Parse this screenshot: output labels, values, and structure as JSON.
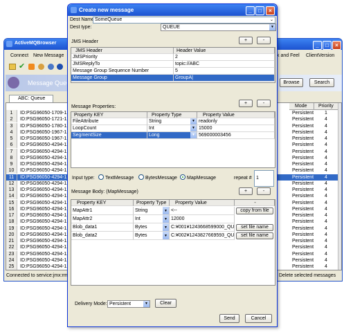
{
  "bg": {
    "title": "ActiveMQBrowser",
    "menu_left": [
      "Connect",
      "New Message"
    ],
    "menu_right": [
      "k and Feel",
      "ClientVersion"
    ],
    "band": "Message Queue",
    "browse": "Browse",
    "search": "Search",
    "tab": "ABC: Queue",
    "col_mode": "Mode",
    "col_priority": "Priority",
    "rows": [
      {
        "n": "1",
        "id": "ID:PSG96050-1709-12",
        "m": "Persistent",
        "p": "1"
      },
      {
        "n": "2",
        "id": "ID:PSG96050-1721-12",
        "m": "Persistent",
        "p": "4"
      },
      {
        "n": "3",
        "id": "ID:PSG96050-1780-12",
        "m": "Persistent",
        "p": "4"
      },
      {
        "n": "4",
        "id": "ID:PSG96050-1967-12",
        "m": "Persistent",
        "p": "4"
      },
      {
        "n": "5",
        "id": "ID:PSG96050-1967-12",
        "m": "Persistent",
        "p": "4"
      },
      {
        "n": "6",
        "id": "ID:PSG96050-4294-12",
        "m": "Persistent",
        "p": "4"
      },
      {
        "n": "7",
        "id": "ID:PSG96050-4294-12",
        "m": "Persistent",
        "p": "4"
      },
      {
        "n": "8",
        "id": "ID:PSG96050-4294-12",
        "m": "Persistent",
        "p": "4"
      },
      {
        "n": "9",
        "id": "ID:PSG96050-4294-12",
        "m": "Persistent",
        "p": "4"
      },
      {
        "n": "10",
        "id": "ID:PSG96050-4294-12",
        "m": "Persistent",
        "p": "4"
      },
      {
        "n": "11",
        "id": "ID:PSG96050-4294-12",
        "m": "Persistent",
        "p": "4"
      },
      {
        "n": "12",
        "id": "ID:PSG96050-4294-12",
        "m": "Persistent",
        "p": "4"
      },
      {
        "n": "13",
        "id": "ID:PSG96050-4294-12",
        "m": "Persistent",
        "p": "4"
      },
      {
        "n": "14",
        "id": "ID:PSG96050-4294-12",
        "m": "Persistent",
        "p": "4"
      },
      {
        "n": "15",
        "id": "ID:PSG96050-4294-12",
        "m": "Persistent",
        "p": "4"
      },
      {
        "n": "16",
        "id": "ID:PSG96050-4294-12",
        "m": "Persistent",
        "p": "4"
      },
      {
        "n": "17",
        "id": "ID:PSG96050-4294-12",
        "m": "Persistent",
        "p": "4"
      },
      {
        "n": "18",
        "id": "ID:PSG96050-4294-12",
        "m": "Persistent",
        "p": "4"
      },
      {
        "n": "19",
        "id": "ID:PSG96050-4294-12",
        "m": "Persistent",
        "p": "4"
      },
      {
        "n": "20",
        "id": "ID:PSG96050-4294-12",
        "m": "Persistent",
        "p": "4"
      },
      {
        "n": "21",
        "id": "ID:PSG96050-4294-12",
        "m": "Persistent",
        "p": "4"
      },
      {
        "n": "22",
        "id": "ID:PSG96050-4294-12",
        "m": "Persistent",
        "p": "4"
      },
      {
        "n": "23",
        "id": "ID:PSG96050-4294-12",
        "m": "Persistent",
        "p": "4"
      },
      {
        "n": "24",
        "id": "ID:PSG96050-4294-12",
        "m": "Persistent",
        "p": "4"
      },
      {
        "n": "25",
        "id": "ID:PSG96050-4294-12",
        "m": "Persistent",
        "p": "4"
      }
    ],
    "status_left": "Connected to service:jmx:rmi",
    "status_right": "Delete selected messages"
  },
  "dlg": {
    "title": "Create new message",
    "dest_name_label": "Dest Name",
    "dest_name_value": "SomeQueue",
    "dest_type_label": "Dest type:",
    "dest_type_value": "QUEUE",
    "jms_section": "JMS Header",
    "jms_col1": "JMS Header",
    "jms_col2": "Header Value",
    "jms_rows": [
      {
        "k": "JMSPriority",
        "v": "2"
      },
      {
        "k": "JMSReplyTo",
        "v": "topic://ABC"
      },
      {
        "k": "Message Group Sequence Number",
        "v": "5"
      },
      {
        "k": "Message Group",
        "v": "GroupA|"
      }
    ],
    "props_section": "Message Properties:",
    "props_cols": [
      "Property KEY",
      "Property Type",
      "Property Value"
    ],
    "props_rows": [
      {
        "k": "FileAttribute",
        "t": "String",
        "v": "readonly"
      },
      {
        "k": "LoopCount",
        "t": "Int",
        "v": "15000"
      },
      {
        "k": "SegmentSize",
        "t": "Long",
        "v": "569000003456"
      }
    ],
    "input_type_label": "Input type:",
    "radio_text": "TextMessage",
    "radio_bytes": "BytesMessage",
    "radio_map": "MapMessage",
    "repeat_label": "repeat #",
    "repeat_value": "1",
    "body_section": "Message Body: (MapMessage)",
    "body_cols": [
      "Property KEY",
      "Property Type",
      "Property Value"
    ],
    "body_rows": [
      {
        "k": "MapAttr1",
        "t": "String",
        "v": "<--",
        "b": "copy from file"
      },
      {
        "k": "MapAttr2",
        "t": "Int",
        "v": "12000",
        "b": ""
      },
      {
        "k": "Blob_data1",
        "t": "Bytes",
        "v": "C:¥001¥1243668599000_QU...",
        "b": "set file name"
      },
      {
        "k": "Blob_data2",
        "t": "Bytes",
        "v": "C:¥002¥1243827669593_QU...",
        "b": "set file name"
      }
    ],
    "delivery_label": "Delivery Mode:",
    "delivery_value": "Persistent",
    "clear": "Clear",
    "send": "Send",
    "cancel": "Cancel",
    "plus": "+",
    "minus": "-"
  }
}
